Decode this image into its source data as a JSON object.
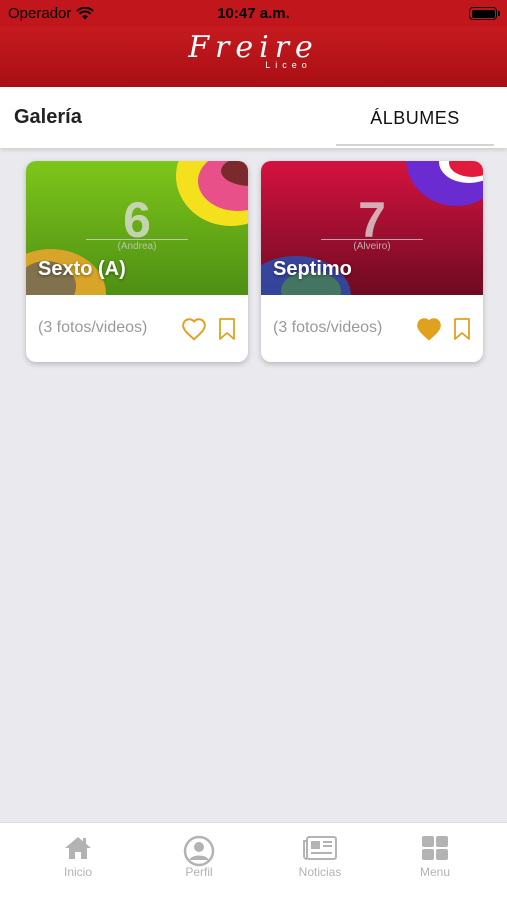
{
  "status_bar": {
    "carrier": "Operador",
    "time": "10:47 a.m."
  },
  "brand": {
    "logo_main": "Freire",
    "logo_sub": "Liceo"
  },
  "header": {
    "title": "Galería",
    "tab_label": "ÁLBUMES"
  },
  "albums": [
    {
      "title": "Sexto (A)",
      "number": "6",
      "subtitle": "(Andrea)",
      "count": "(3 fotos/videos)",
      "liked": false
    },
    {
      "title": "Septimo",
      "number": "7",
      "subtitle": "(Alveiro)",
      "count": "(3 fotos/videos)",
      "liked": true
    }
  ],
  "tabbar": {
    "items": [
      "Inicio",
      "Perfil",
      "Noticias",
      "Menu"
    ]
  },
  "colors": {
    "brand_red": "#c0161c",
    "accent_gold": "#e0a21e",
    "tab_gray": "#b3b3b3"
  },
  "icons": [
    "wifi-icon",
    "battery-icon",
    "heart-icon",
    "heart-filled-icon",
    "bookmark-icon",
    "home-icon",
    "profile-icon",
    "newspaper-icon",
    "grid-icon"
  ]
}
